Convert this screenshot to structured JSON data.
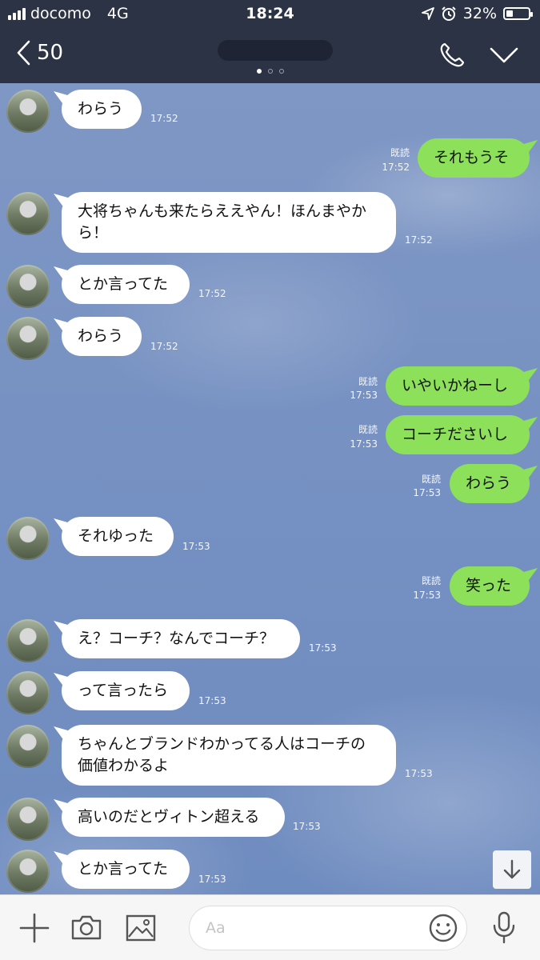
{
  "status_bar": {
    "carrier": "docomo",
    "network": "4G",
    "time": "18:24",
    "battery": "32%",
    "battery_level": 0.32
  },
  "nav": {
    "back_count": "50"
  },
  "messages": [
    {
      "side": "in",
      "text": "わらう",
      "time": "17:52"
    },
    {
      "side": "out",
      "read": "既読",
      "text": "それもうそ",
      "time": "17:52"
    },
    {
      "side": "in",
      "text": "大将ちゃんも来たらええやん！ほんまやか\nら！",
      "time": "17:52"
    },
    {
      "side": "in",
      "text": "とか言ってた",
      "time": "17:52"
    },
    {
      "side": "in",
      "text": "わらう",
      "time": "17:52"
    },
    {
      "side": "out",
      "read": "既読",
      "text": "いやいかねーし",
      "time": "17:53"
    },
    {
      "side": "out",
      "read": "既読",
      "text": "コーチださいし",
      "time": "17:53"
    },
    {
      "side": "out",
      "read": "既読",
      "text": "わらう",
      "time": "17:53"
    },
    {
      "side": "in",
      "text": "それゆった",
      "time": "17:53"
    },
    {
      "side": "out",
      "read": "既読",
      "text": "笑った",
      "time": "17:53"
    },
    {
      "side": "in",
      "text": "え？コーチ？なんでコーチ？",
      "time": "17:53"
    },
    {
      "side": "in",
      "text": "って言ったら",
      "time": "17:53"
    },
    {
      "side": "in",
      "text": "ちゃんとブランドわかってる人はコーチの\n価値わかるよ",
      "time": "17:53"
    },
    {
      "side": "in",
      "text": "高いのだとヴィトン超える",
      "time": "17:53"
    },
    {
      "side": "in",
      "text": "とか言ってた",
      "time": "17:53"
    }
  ],
  "input": {
    "placeholder": "Aa"
  },
  "colors": {
    "header": "#2b3345",
    "bubble_out": "#8ce05a",
    "bubble_in": "#ffffff"
  }
}
